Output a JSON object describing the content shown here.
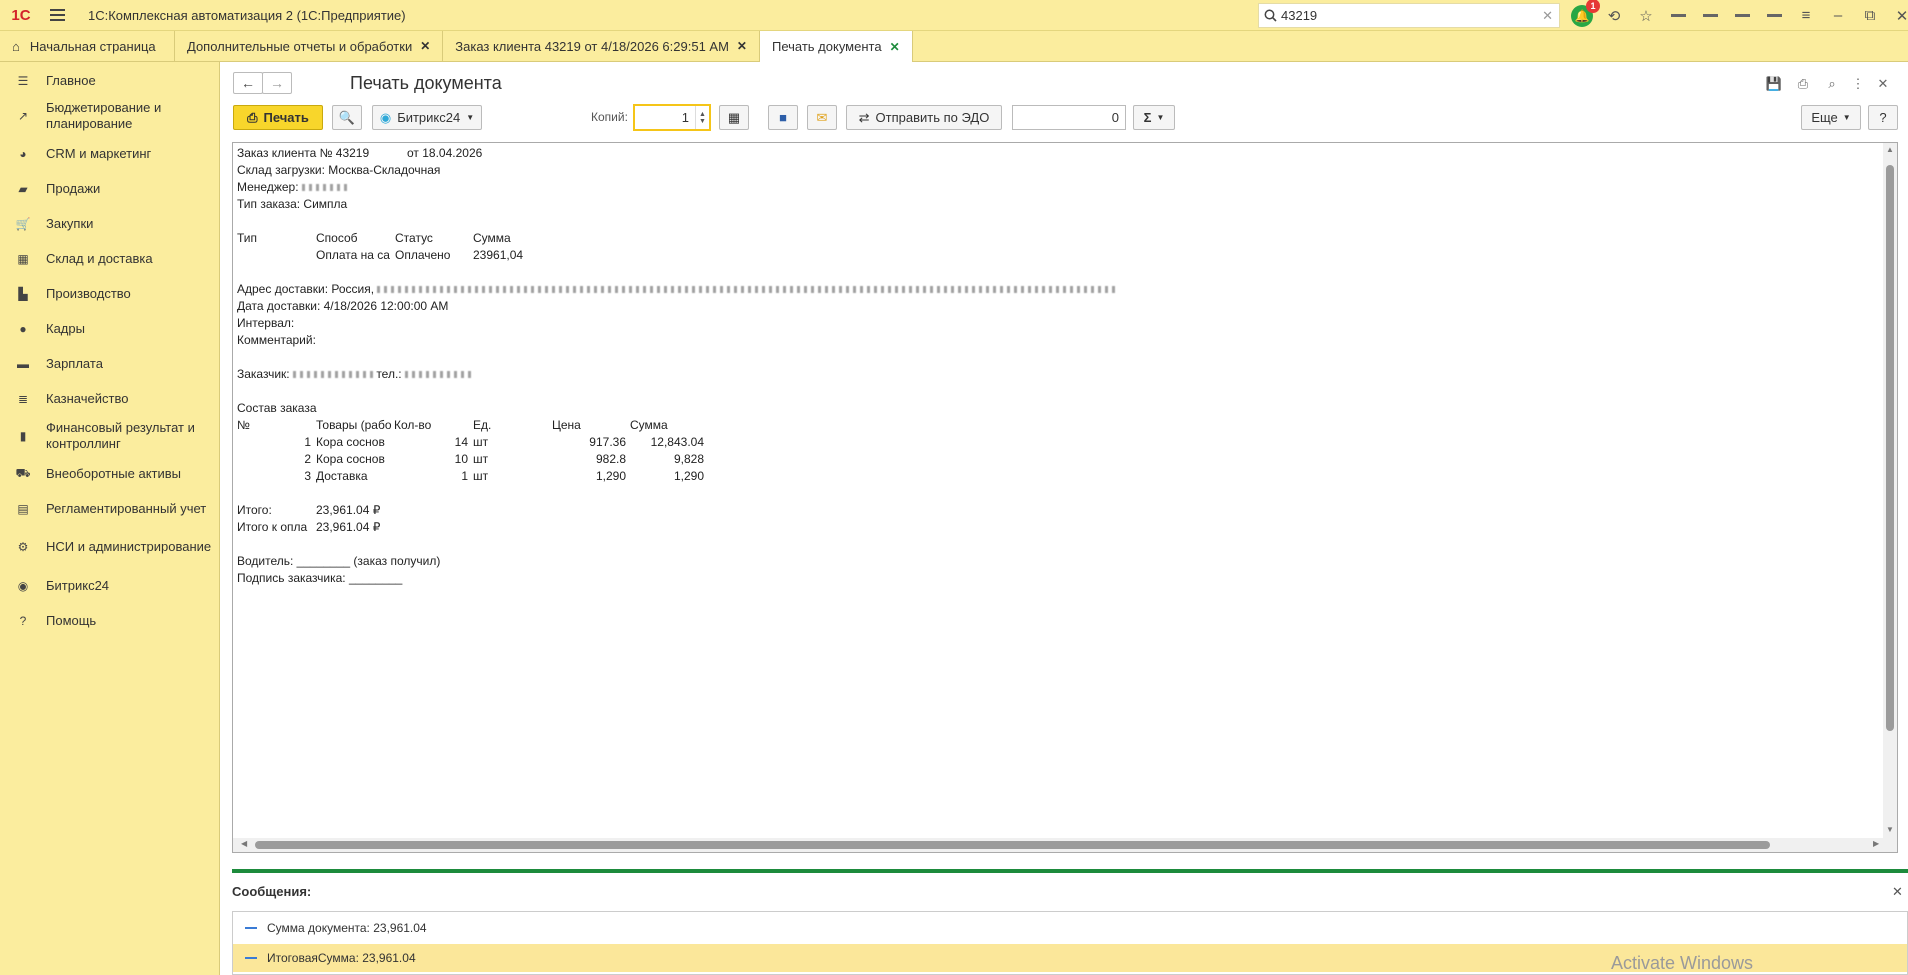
{
  "app": {
    "logo": "1С",
    "title": "1С:Комплексная автоматизация 2 (1С:Предприятие)",
    "search_value": "43219",
    "notification_count": "1"
  },
  "tabs": [
    {
      "label": "Начальная страница"
    },
    {
      "label": "Дополнительные отчеты и обработки"
    },
    {
      "label": "Заказ клиента 43219 от 4/18/2026 6:29:51 AM"
    },
    {
      "label": "Печать документа"
    }
  ],
  "sidebar": {
    "items": [
      {
        "label": "Главное",
        "icon": "menu-icon"
      },
      {
        "label": "Бюджетирование и планирование",
        "icon": "chart-icon"
      },
      {
        "label": "CRM и маркетинг",
        "icon": "pie-icon"
      },
      {
        "label": "Продажи",
        "icon": "bag-icon"
      },
      {
        "label": "Закупки",
        "icon": "cart-icon"
      },
      {
        "label": "Склад и доставка",
        "icon": "warehouse-icon"
      },
      {
        "label": "Производство",
        "icon": "factory-icon"
      },
      {
        "label": "Кадры",
        "icon": "person-icon"
      },
      {
        "label": "Зарплата",
        "icon": "wallet-icon"
      },
      {
        "label": "Казначейство",
        "icon": "coins-icon"
      },
      {
        "label": "Финансовый результат и контроллинг",
        "icon": "bars-icon"
      },
      {
        "label": "Внеоборотные активы",
        "icon": "truck-icon"
      },
      {
        "label": "Регламентированный учет",
        "icon": "book-icon"
      },
      {
        "label": "НСИ и администрирование",
        "icon": "gear-icon"
      },
      {
        "label": "Битрикс24",
        "icon": "bitrix-icon"
      },
      {
        "label": "Помощь",
        "icon": "help-icon"
      }
    ]
  },
  "form": {
    "title": "Печать документа",
    "print_label": "Печать",
    "bitrix_label": "Битрикс24",
    "copies_label": "Копий:",
    "copies_value": "1",
    "edo_label": "Отправить по ЭДО",
    "sum_value": "0",
    "sigma_label": "Σ",
    "more_label": "Еще",
    "help_label": "?"
  },
  "document": {
    "order_header": "Заказ клиента № 43219",
    "order_date": "от 18.04.2026",
    "warehouse": "Склад загрузки: Москва-Складочная",
    "manager": "Менеджер:",
    "order_type": "Тип заказа: Симпла",
    "pay_headers": [
      "Тип",
      "Способ",
      "Статус",
      "Сумма"
    ],
    "pay_row": [
      "Оплата на са",
      "Оплачено",
      "23961,04"
    ],
    "address": "Адрес доставки: Россия,",
    "delivery_date": "Дата доставки: 4/18/2026 12:00:00 AM",
    "interval": "Интервал:",
    "comment": "Комментарий:",
    "customer": "Заказчик:",
    "phone": "тел.:",
    "composition": "Состав заказа",
    "item_headers": [
      "№",
      "Товары (рабо",
      "Кол-во",
      "Ед.",
      "Цена",
      "Сумма"
    ],
    "items": [
      {
        "n": "1",
        "name": "Кора соснов",
        "qty": "14",
        "unit": "шт",
        "price": "917.36",
        "sum": "12,843.04"
      },
      {
        "n": "2",
        "name": "Кора соснов",
        "qty": "10",
        "unit": "шт",
        "price": "982.8",
        "sum": "9,828"
      },
      {
        "n": "3",
        "name": "Доставка",
        "qty": "1",
        "unit": "шт",
        "price": "1,290",
        "sum": "1,290"
      }
    ],
    "total_label": "Итого:",
    "total_value": "23,961.04 ₽",
    "topay_label": "Итого к опла",
    "topay_value": "23,961.04 ₽",
    "driver": "Водитель: ________ (заказ получил)",
    "signature": "Подпись заказчика: ________"
  },
  "messages": {
    "title": "Сообщения:",
    "rows": [
      {
        "text": "Сумма документа: 23,961.04"
      },
      {
        "text": "ИтоговаяСумма: 23,961.04"
      }
    ],
    "watermark": "Activate Windows"
  },
  "colors": {
    "panel": "#fbed9e",
    "accent_green": "#1d8b3c",
    "print_button": "#f8d62b"
  }
}
